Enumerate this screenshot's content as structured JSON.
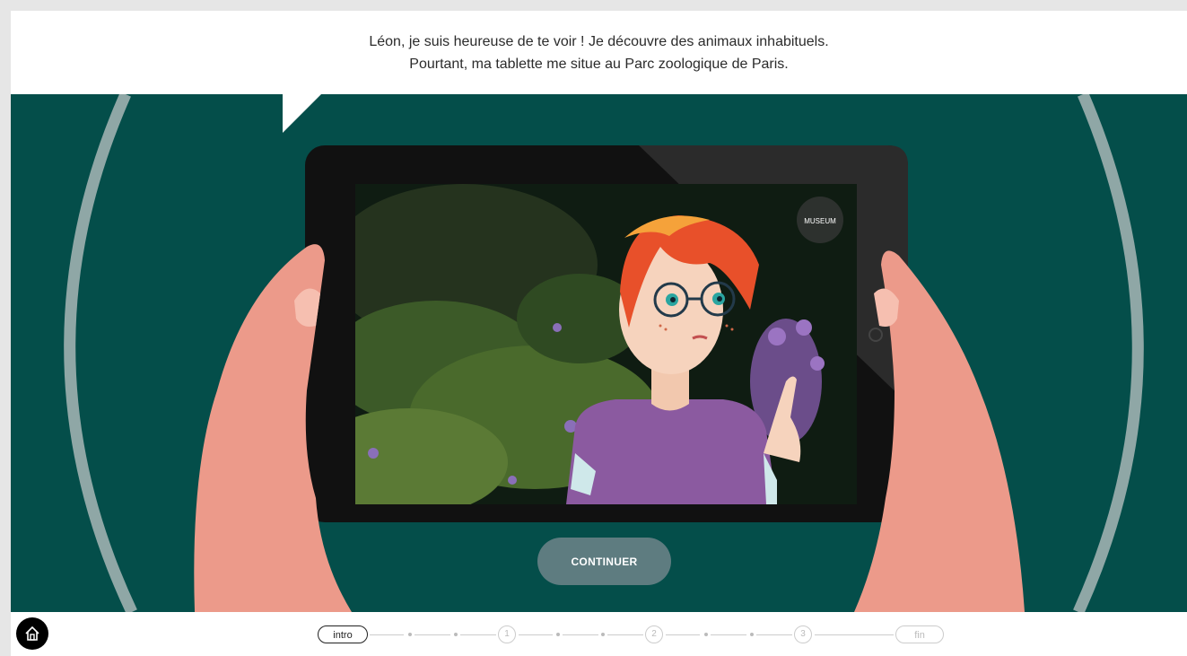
{
  "dialogue": {
    "line1": "Léon, je suis heureuse de te voir ! Je découvre des animaux inhabituels.",
    "line2": "Pourtant, ma tablette me situe au Parc zoologique de Paris."
  },
  "continue_label": "CONTINUER",
  "tablet_logo": "MUSEUM",
  "progress": {
    "steps": [
      {
        "type": "pill",
        "label": "intro",
        "active": true
      },
      {
        "type": "dot"
      },
      {
        "type": "dot"
      },
      {
        "type": "circle",
        "label": "1"
      },
      {
        "type": "dot"
      },
      {
        "type": "dot"
      },
      {
        "type": "circle",
        "label": "2"
      },
      {
        "type": "dot"
      },
      {
        "type": "dot"
      },
      {
        "type": "circle",
        "label": "3"
      },
      {
        "type": "pill",
        "label": "fin",
        "active": false
      }
    ]
  },
  "colors": {
    "scene_bg": "#044e4a",
    "arc": "#8fa7a6",
    "tablet": "#111111",
    "skin": "#ec9a8a",
    "hair": "#e8502a",
    "shirt": "#8b5aa0",
    "button": "#5e7c80"
  },
  "icons": {
    "home": "home-icon",
    "camera": "camera-icon"
  }
}
